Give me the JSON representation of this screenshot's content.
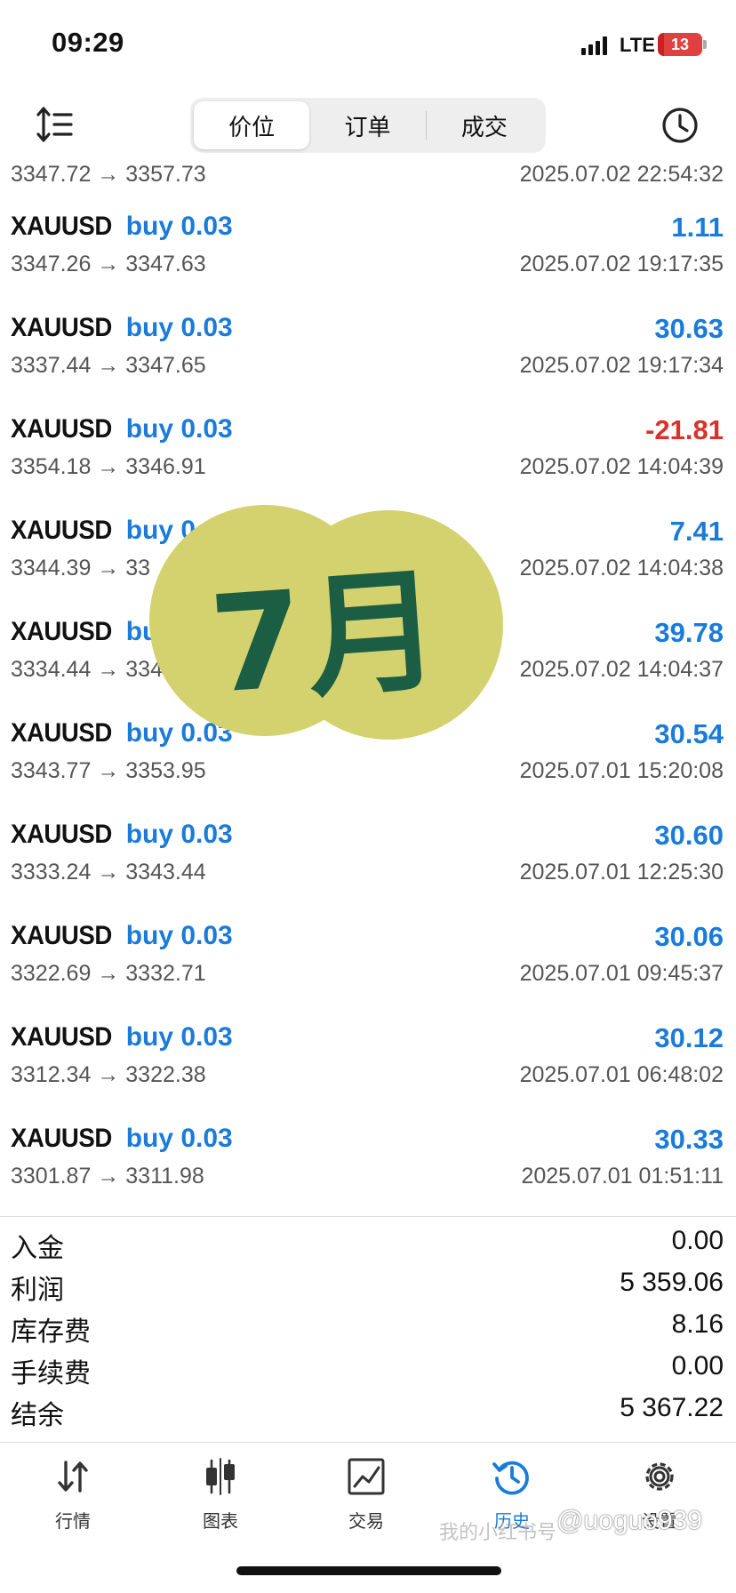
{
  "status_bar": {
    "time": "09:29",
    "network": "LTE",
    "battery": "13",
    "battery_level": 0.13
  },
  "toolbar": {
    "tabs": [
      {
        "label": "价位",
        "active": true
      },
      {
        "label": "订单",
        "active": false
      },
      {
        "label": "成交",
        "active": false
      }
    ]
  },
  "first_row": {
    "prices": "3347.72 → 3357.73",
    "time": "2025.07.02 22:54:32"
  },
  "deals": [
    {
      "symbol": "XAUUSD",
      "side": "buy 0.03",
      "profit": "1.11",
      "prices": "3347.26 → 3347.63",
      "time": "2025.07.02 19:17:35"
    },
    {
      "symbol": "XAUUSD",
      "side": "buy 0.03",
      "profit": "30.63",
      "prices": "3337.44 → 3347.65",
      "time": "2025.07.02 19:17:34"
    },
    {
      "symbol": "XAUUSD",
      "side": "buy 0.03",
      "profit": "-21.81",
      "prices": "3354.18 → 3346.91",
      "time": "2025.07.02 14:04:39"
    },
    {
      "symbol": "XAUUSD",
      "side": "buy 0.03",
      "profit": "7.41",
      "prices": "3344.39 → 33",
      "time": "2025.07.02 14:04:38"
    },
    {
      "symbol": "XAUUSD",
      "side": "buy",
      "profit": "39.78",
      "prices": "3334.44 → 334",
      "time": "2025.07.02 14:04:37"
    },
    {
      "symbol": "XAUUSD",
      "side": "buy 0.03",
      "profit": "30.54",
      "prices": "3343.77 → 3353.95",
      "time": "2025.07.01 15:20:08"
    },
    {
      "symbol": "XAUUSD",
      "side": "buy 0.03",
      "profit": "30.60",
      "prices": "3333.24 → 3343.44",
      "time": "2025.07.01 12:25:30"
    },
    {
      "symbol": "XAUUSD",
      "side": "buy 0.03",
      "profit": "30.06",
      "prices": "3322.69 → 3332.71",
      "time": "2025.07.01 09:45:37"
    },
    {
      "symbol": "XAUUSD",
      "side": "buy 0.03",
      "profit": "30.12",
      "prices": "3312.34 → 3322.38",
      "time": "2025.07.01 06:48:02"
    },
    {
      "symbol": "XAUUSD",
      "side": "buy 0.03",
      "profit": "30.33",
      "prices": "3301.87 → 3311.98",
      "time": "2025.07.01 01:51:11"
    }
  ],
  "summary": [
    {
      "label": "入金",
      "value": "0.00"
    },
    {
      "label": "利润",
      "value": "5 359.06"
    },
    {
      "label": "库存费",
      "value": "8.16"
    },
    {
      "label": "手续费",
      "value": "0.00"
    },
    {
      "label": "结余",
      "value": "5 367.22"
    }
  ],
  "tabbar": [
    {
      "label": "行情",
      "icon": "quotes-arrows-icon",
      "active": false
    },
    {
      "label": "图表",
      "icon": "candlestick-icon",
      "active": false
    },
    {
      "label": "交易",
      "icon": "trade-chart-icon",
      "active": false
    },
    {
      "label": "历史",
      "icon": "history-icon",
      "active": true
    },
    {
      "label": "设置",
      "icon": "gear-icon",
      "active": false
    }
  ],
  "overlay": {
    "text": "7月"
  },
  "watermark": {
    "text": "我的小红书号",
    "handle": "@uoguo939"
  },
  "colors": {
    "accent": "#1a7bd8",
    "negative": "#d8322a",
    "sticker": "#d4d26e",
    "sticker_text": "#1b5e44"
  }
}
